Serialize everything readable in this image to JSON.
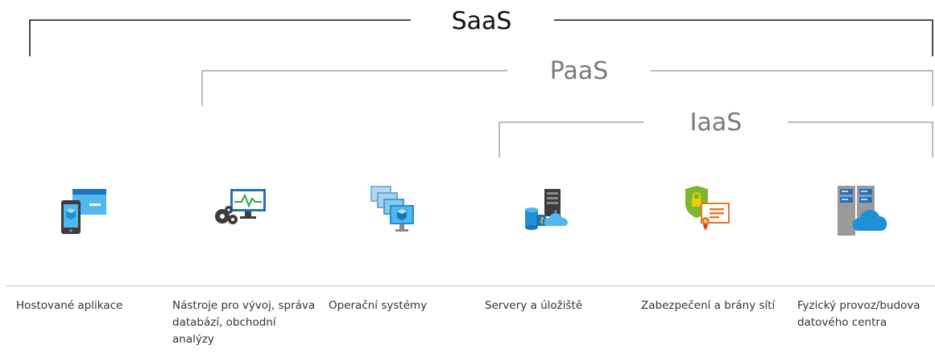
{
  "tiers": {
    "saas": "SaaS",
    "paas": "PaaS",
    "iaas": "IaaS"
  },
  "categories": [
    {
      "label": "Hostované aplikace",
      "icon": "hosted-app-icon"
    },
    {
      "label": "Nástroje pro vývoj, správa databází, obchodní analýzy",
      "icon": "dev-tools-icon"
    },
    {
      "label": "Operační systémy",
      "icon": "operating-systems-icon"
    },
    {
      "label": "Servery a úložiště",
      "icon": "servers-storage-icon"
    },
    {
      "label": "Zabezpečení a brány sítí",
      "icon": "security-icon"
    },
    {
      "label": "Fyzický provoz/budova datového centra",
      "icon": "datacenter-icon"
    }
  ],
  "colors": {
    "saas_line": "#111111",
    "paas_iaas_line": "#a6a6a6",
    "azure_blue": "#1e90d6",
    "light_blue": "#50b8ef",
    "dark_gray": "#3c3c3c"
  }
}
